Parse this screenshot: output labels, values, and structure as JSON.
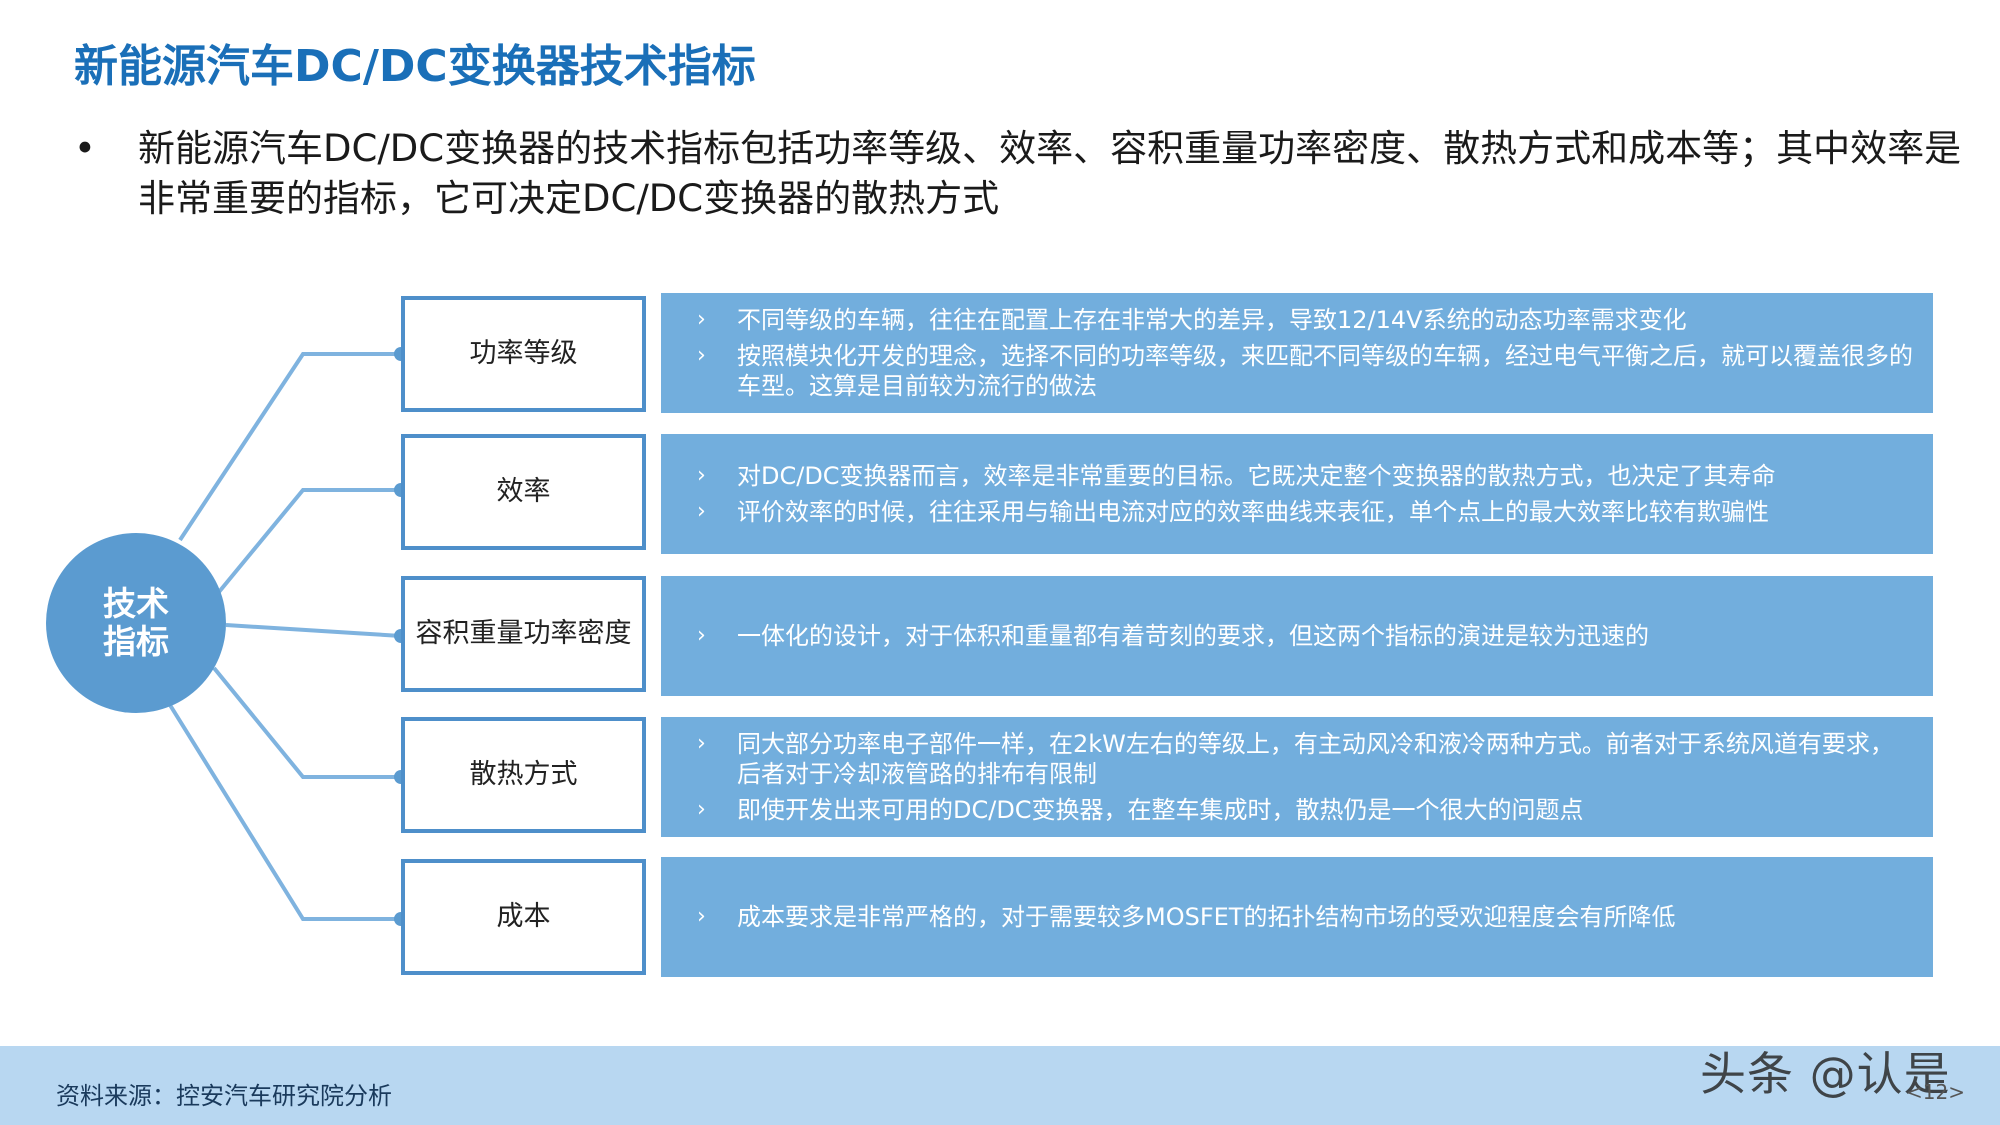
{
  "title": "新能源汽车DC/DC变换器技术指标",
  "intro": {
    "bullet": "•",
    "text": "新能源汽车DC/DC变换器的技术指标包括功率等级、效率、容积重量功率密度、散热方式和成本等；其中效率是非常重要的指标，它可决定DC/DC变换器的散热方式"
  },
  "hub": {
    "label": "技术指标"
  },
  "rows": [
    {
      "label": "功率等级",
      "bullets": [
        "不同等级的车辆，往往在配置上存在非常大的差异，导致12/14V系统的动态功率需求变化",
        "按照模块化开发的理念，选择不同的功率等级，来匹配不同等级的车辆，经过电气平衡之后，就可以覆盖很多的车型。这算是目前较为流行的做法"
      ]
    },
    {
      "label": "效率",
      "bullets": [
        "对DC/DC变换器而言，效率是非常重要的目标。它既决定整个变换器的散热方式，也决定了其寿命",
        "评价效率的时候，往往采用与输出电流对应的效率曲线来表征，单个点上的最大效率比较有欺骗性"
      ]
    },
    {
      "label": "容积重量功率密度",
      "bullets": [
        "一体化的设计，对于体积和重量都有着苛刻的要求，但这两个指标的演进是较为迅速的"
      ]
    },
    {
      "label": "散热方式",
      "bullets": [
        "同大部分功率电子部件一样，在2kW左右的等级上，有主动风冷和液冷两种方式。前者对于系统风道有要求，后者对于冷却液管路的排布有限制",
        "即使开发出来可用的DC/DC变换器，在整车集成时，散热仍是一个很大的问题点"
      ]
    },
    {
      "label": "成本",
      "bullets": [
        "成本要求是非常严格的，对于需要较多MOSFET的拓扑结构市场的受欢迎程度会有所降低"
      ]
    }
  ],
  "arrow_glyph": "›",
  "footer": {
    "source": "资料来源：控安汽车研究院分析",
    "watermark": "头条 @认是",
    "page": "<12>"
  },
  "colors": {
    "title": "#1a6fb8",
    "hub": "#5b9bd0",
    "box_border": "#4e8fca",
    "desc_fill": "#72aedd",
    "footer_band": "#b8d7f1"
  }
}
